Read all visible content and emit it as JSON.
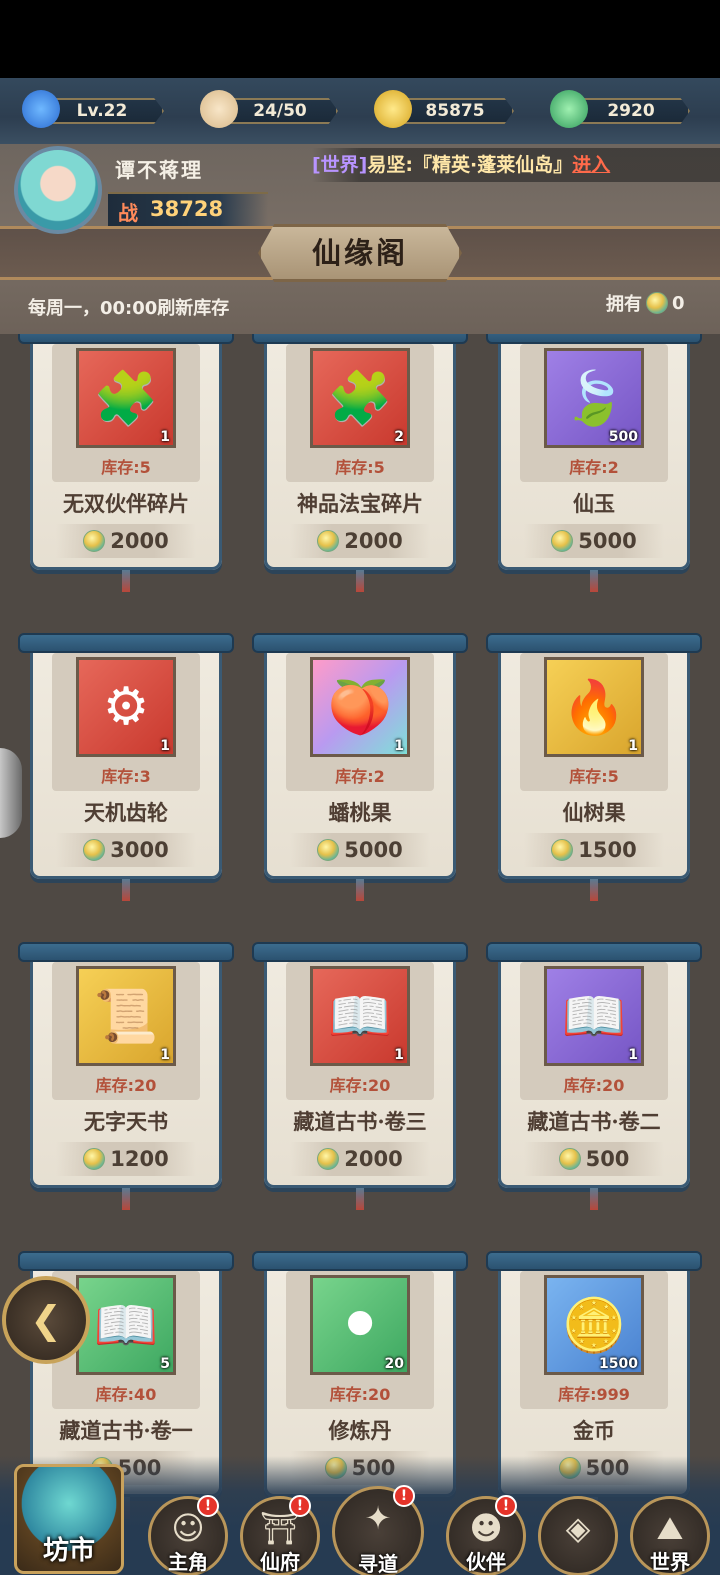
{
  "resources": {
    "level": "Lv.22",
    "stamina": "24/50",
    "gold": "85875",
    "jade": "2920"
  },
  "player": {
    "name": "谭不蒋理",
    "power_label": "战",
    "power_value": "38728"
  },
  "broadcast": {
    "channel": "[世界]",
    "sender": "易坚:",
    "message": "『精英·蓬莱仙岛』",
    "link": "进入"
  },
  "page": {
    "title": "仙缘阁",
    "refresh_text": "每周一，00:00刷新库存",
    "owned_label": "拥有",
    "owned_value": "0"
  },
  "items": [
    {
      "name": "无双伙伴碎片",
      "stock": "库存:5",
      "qty": "1",
      "price": "2000",
      "color": "red",
      "icon": "puzzle-piece-icon",
      "glyph": "🧩"
    },
    {
      "name": "神品法宝碎片",
      "stock": "库存:5",
      "qty": "2",
      "price": "2000",
      "color": "red",
      "icon": "puzzle-pieces-icon",
      "glyph": "🧩"
    },
    {
      "name": "仙玉",
      "stock": "库存:2",
      "qty": "500",
      "price": "5000",
      "color": "purple",
      "icon": "jade-leaf-icon",
      "glyph": "🍃"
    },
    {
      "name": "天机齿轮",
      "stock": "库存:3",
      "qty": "1",
      "price": "3000",
      "color": "red",
      "icon": "gear-icon",
      "glyph": "⚙"
    },
    {
      "name": "蟠桃果",
      "stock": "库存:2",
      "qty": "1",
      "price": "5000",
      "color": "rainbow",
      "icon": "peach-icon",
      "glyph": "🍑"
    },
    {
      "name": "仙树果",
      "stock": "库存:5",
      "qty": "1",
      "price": "1500",
      "color": "gold",
      "icon": "fire-fruit-icon",
      "glyph": "🔥"
    },
    {
      "name": "无字天书",
      "stock": "库存:20",
      "qty": "1",
      "price": "1200",
      "color": "gold",
      "icon": "scroll-book-icon",
      "glyph": "📜"
    },
    {
      "name": "藏道古书·卷三",
      "stock": "库存:20",
      "qty": "1",
      "price": "2000",
      "color": "red",
      "icon": "open-book-icon",
      "glyph": "📖"
    },
    {
      "name": "藏道古书·卷二",
      "stock": "库存:20",
      "qty": "1",
      "price": "500",
      "color": "purple",
      "icon": "open-book-icon",
      "glyph": "📖"
    },
    {
      "name": "藏道古书·卷一",
      "stock": "库存:40",
      "qty": "5",
      "price": "500",
      "color": "green",
      "icon": "open-book-icon",
      "glyph": "📖"
    },
    {
      "name": "修炼丹",
      "stock": "库存:20",
      "qty": "20",
      "price": "500",
      "color": "green",
      "icon": "pill-bowl-icon",
      "glyph": "⚫"
    },
    {
      "name": "金币",
      "stock": "库存:999",
      "qty": "1500",
      "price": "500",
      "color": "blue",
      "icon": "gold-coin-icon",
      "glyph": "🪙"
    }
  ],
  "nav": {
    "market": "坊市",
    "hero": "主角",
    "mansion": "仙府",
    "quest": "寻道",
    "partner": "伙伴",
    "world": "世界",
    "badge": "!"
  }
}
